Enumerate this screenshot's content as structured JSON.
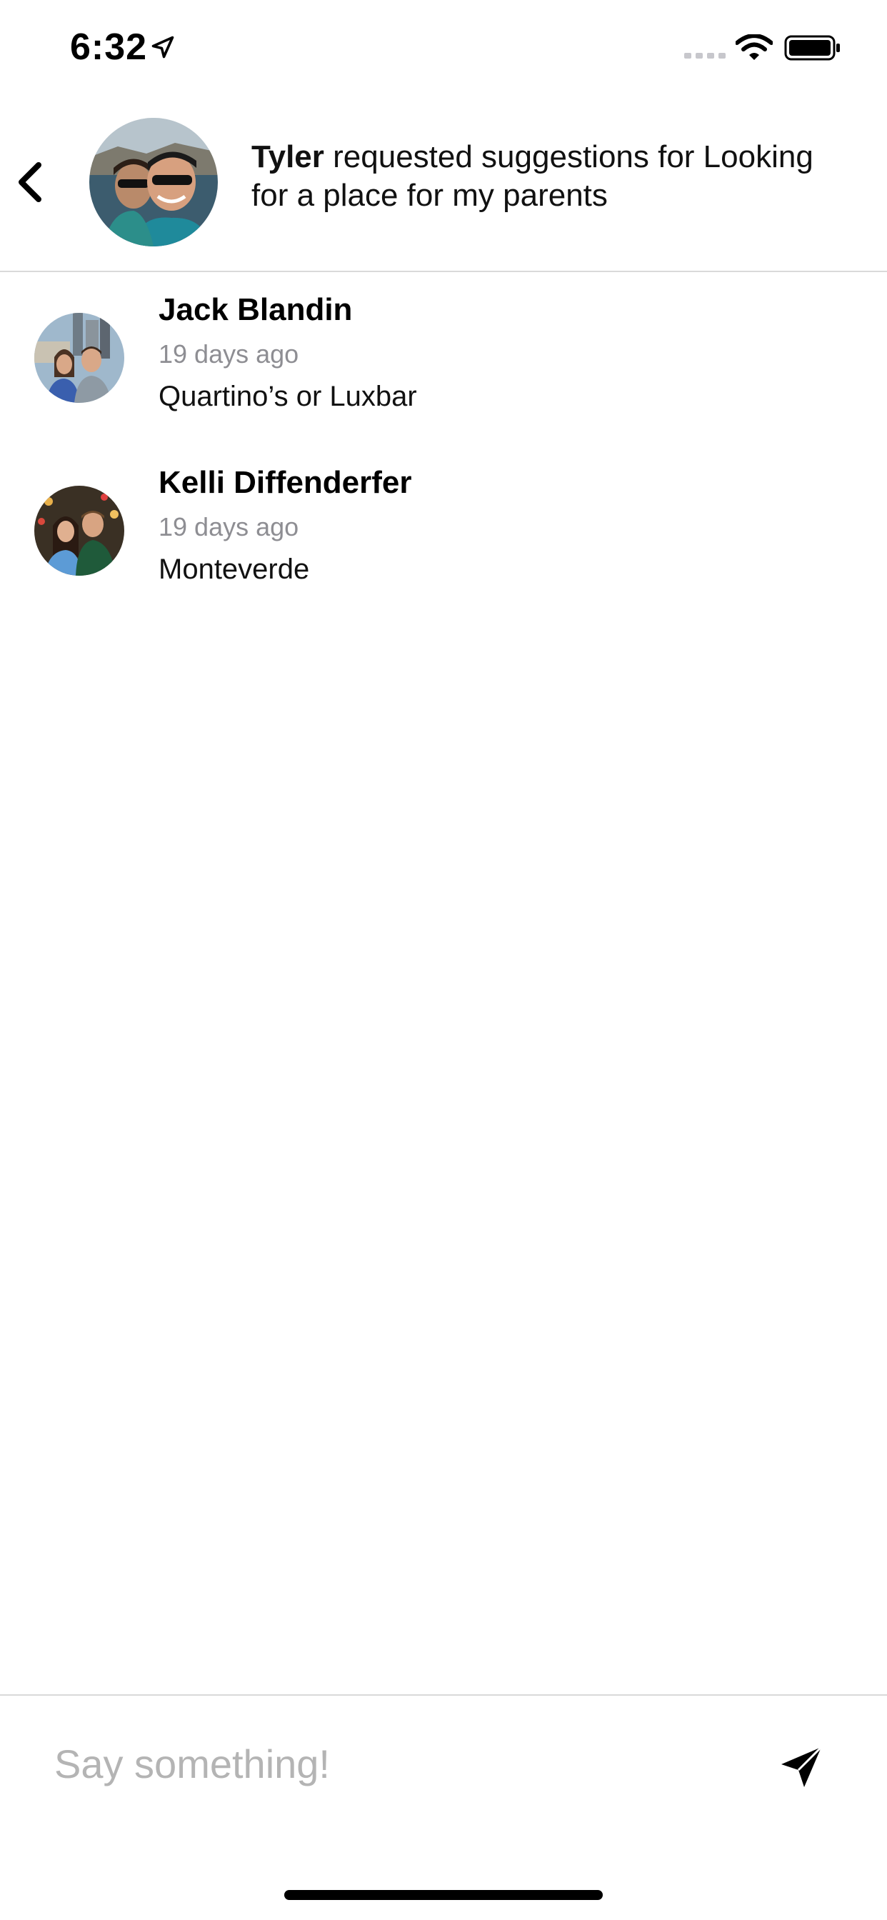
{
  "status_bar": {
    "time": "6:32",
    "icons": [
      "location-arrow-icon",
      "signal-icon",
      "wifi-icon",
      "battery-icon"
    ]
  },
  "header": {
    "back_icon": "chevron-left-icon",
    "requester_name": "Tyler",
    "request_text": " requested suggestions for Looking for a place for my parents"
  },
  "comments": [
    {
      "name": "Jack Blandin",
      "time": "19 days ago",
      "body": "Quartino’s or Luxbar"
    },
    {
      "name": "Kelli Diffenderfer",
      "time": "19 days ago",
      "body": "Monteverde"
    }
  ],
  "composer": {
    "placeholder": "Say something!",
    "value": "",
    "send_icon": "send-icon"
  },
  "colors": {
    "text": "#000000",
    "muted": "#8e8e93",
    "placeholder": "#b4b4b4",
    "divider": "#d9d9d9"
  }
}
